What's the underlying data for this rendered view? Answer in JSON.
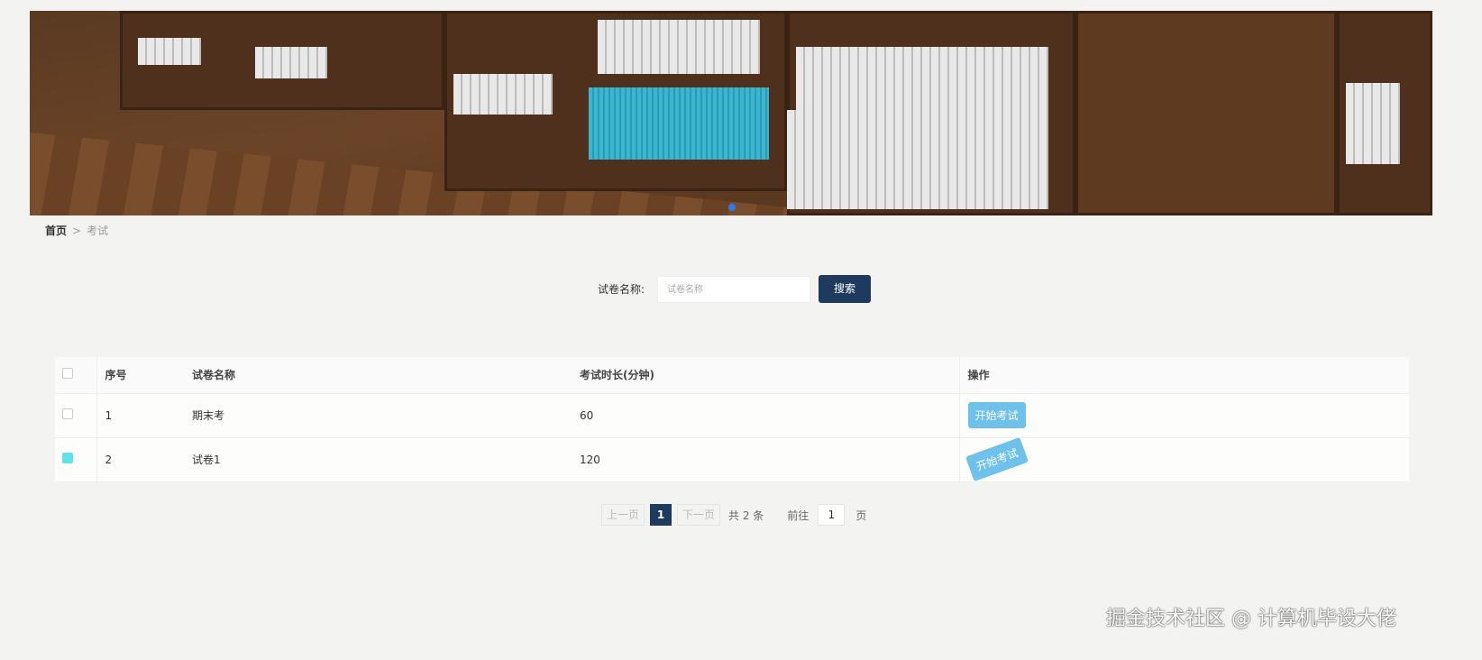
{
  "breadcrumb": {
    "home": "首页",
    "sep": ">",
    "current": "考试"
  },
  "search": {
    "label": "试卷名称:",
    "placeholder": "试卷名称",
    "button": "搜索"
  },
  "table": {
    "headers": [
      "序号",
      "试卷名称",
      "考试时长(分钟)",
      "操作"
    ],
    "rows": [
      {
        "index": "1",
        "name": "期末考",
        "duration": "60",
        "action": "开始考试",
        "checked": false
      },
      {
        "index": "2",
        "name": "试卷1",
        "duration": "120",
        "action": "开始考试",
        "checked": true
      }
    ]
  },
  "pagination": {
    "prev": "上一页",
    "page": "1",
    "next": "下一页",
    "total": "共 2 条",
    "goto_label": "前往",
    "goto_value": "1",
    "page_suffix": "页"
  },
  "watermark": "掘金技术社区 @ 计算机毕设大佬"
}
